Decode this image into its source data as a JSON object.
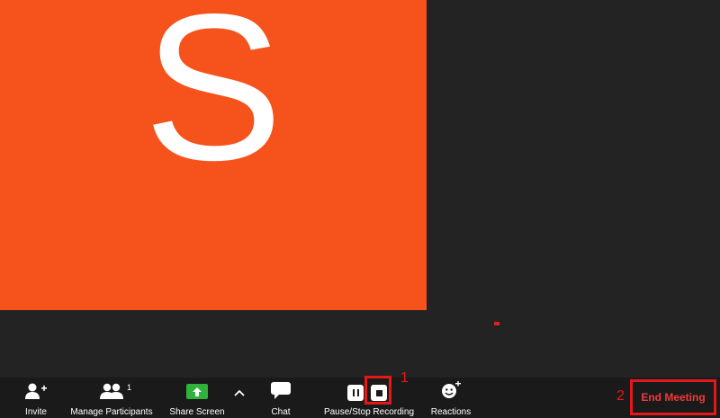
{
  "video": {
    "avatar_letter": "S",
    "tile_color": "#f6521c"
  },
  "toolbar": {
    "invite_label": "Invite",
    "manage_participants_label": "Manage Participants",
    "participant_count": "1",
    "share_screen_label": "Share Screen",
    "chat_label": "Chat",
    "recording_label": "Pause/Stop Recording",
    "reactions_label": "Reactions",
    "end_meeting_label": "End Meeting"
  },
  "annotations": {
    "marker_1": "1",
    "marker_2": "2",
    "color": "#e41818"
  },
  "icons": {
    "invite": "add-user-icon",
    "participants": "participants-icon",
    "share": "share-screen-icon",
    "options": "caret-up-icon",
    "chat": "chat-bubble-icon",
    "pause": "pause-icon",
    "stop": "stop-icon",
    "reactions": "emoji-add-icon"
  }
}
